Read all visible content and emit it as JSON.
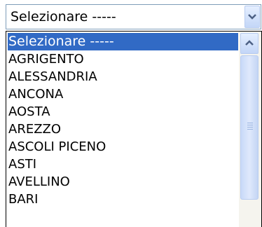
{
  "select": {
    "value": "Selezionare -----",
    "arrow_icon": "chevron-down-icon"
  },
  "dropdown": {
    "options": [
      "Selezionare -----",
      "AGRIGENTO",
      "ALESSANDRIA",
      "ANCONA",
      "AOSTA",
      "AREZZO",
      "ASCOLI PICENO",
      "ASTI",
      "AVELLINO",
      "BARI"
    ],
    "selected_index": 0,
    "scroll_up_icon": "chevron-up-icon",
    "grip_icon": "scrollbar-grip-icon"
  },
  "colors": {
    "selection": "#316ac5",
    "selection_text": "#ffffff",
    "border": "#7f9db9",
    "arrow": "#4d6185"
  }
}
